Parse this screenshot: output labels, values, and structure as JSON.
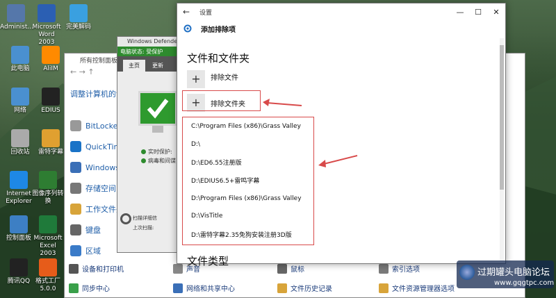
{
  "desktop": {
    "icons": [
      {
        "label": "Administ...",
        "color": "#5577aa"
      },
      {
        "label": "Microsoft Word 2003",
        "color": "#2b5fb3"
      },
      {
        "label": "完美解码",
        "color": "#3aa0e0"
      },
      {
        "label": "此电脑",
        "color": "#4a90d0"
      },
      {
        "label": "AliIM",
        "color": "#ff8a00"
      },
      {
        "label": "网络",
        "color": "#4a90d0"
      },
      {
        "label": "EDIUS",
        "color": "#222222"
      },
      {
        "label": "回收站",
        "color": "#aaaaaa"
      },
      {
        "label": "雷特字幕",
        "color": "#e0a030"
      },
      {
        "label": "Internet Explorer",
        "color": "#1e88e5"
      },
      {
        "label": "图像序列转换",
        "color": "#2e7d32"
      },
      {
        "label": "控制面板",
        "color": "#3d7fc4"
      },
      {
        "label": "Microsoft Excel 2003",
        "color": "#1f7a3a"
      },
      {
        "label": "腾讯QQ",
        "color": "#222222"
      },
      {
        "label": "格式工厂 5.0.0",
        "color": "#e65c1a"
      }
    ]
  },
  "control_panel": {
    "title": "所有控制面板项",
    "nav": "← → ↑",
    "heading": "调整计算机的设置",
    "items": [
      {
        "label": "BitLocker",
        "color": "#999999"
      },
      {
        "label": "QuickTim",
        "color": "#1a73c7"
      },
      {
        "label": "Windows",
        "color": "#3a6fb7"
      },
      {
        "label": "存储空间",
        "color": "#777777"
      },
      {
        "label": "工作文件夹",
        "color": "#d8a43a"
      },
      {
        "label": "键盘",
        "color": "#666666"
      },
      {
        "label": "区域",
        "color": "#3a7bc8"
      }
    ],
    "bottom_row1": [
      {
        "label": "设备和打印机",
        "color": "#555555"
      },
      {
        "label": "声音",
        "color": "#888888"
      },
      {
        "label": "鼠标",
        "color": "#666666"
      },
      {
        "label": "索引选项",
        "color": "#7a7a7a"
      }
    ],
    "bottom_row2": [
      {
        "label": "同步中心",
        "color": "#3aa04a"
      },
      {
        "label": "网络和共享中心",
        "color": "#3a6fb7"
      },
      {
        "label": "文件历史记录",
        "color": "#d8a43a"
      },
      {
        "label": "文件资源管理器选项",
        "color": "#d8a43a"
      }
    ]
  },
  "defender": {
    "title": "Windows Defender",
    "status": "电脑状态: 受保护",
    "tabs": [
      "主页",
      "更新"
    ],
    "lines": [
      "实时保护:",
      "病毒和间谍"
    ],
    "scan": "扫描详细信",
    "scan2": "上次扫描:"
  },
  "settings": {
    "title": "设置",
    "back": "←",
    "minimize": "—",
    "maximize": "☐",
    "close": "✕",
    "header": "添加排除项",
    "section_files": "文件和文件夹",
    "exclude_file": "排除文件",
    "exclude_folder": "排除文件夹",
    "paths": [
      "C:\\Program Files (x86)\\Grass Valley",
      "D:\\",
      "D:\\ED6.55注册版",
      "D:\\EDIUS6.5+雷鸣字幕",
      "D:\\Program Files (x86)\\Grass Valley",
      "D:\\VisTitle",
      "D:\\雷特字幕2.35免狗安装注册3D版"
    ],
    "section_types": "文件类型"
  },
  "watermark": {
    "line1": "过期罐头电脑论坛",
    "line2": "www.gqgtpc.com"
  },
  "colors": {
    "annotation_red": "#d84a4a",
    "defender_green": "#2e8b2e"
  }
}
